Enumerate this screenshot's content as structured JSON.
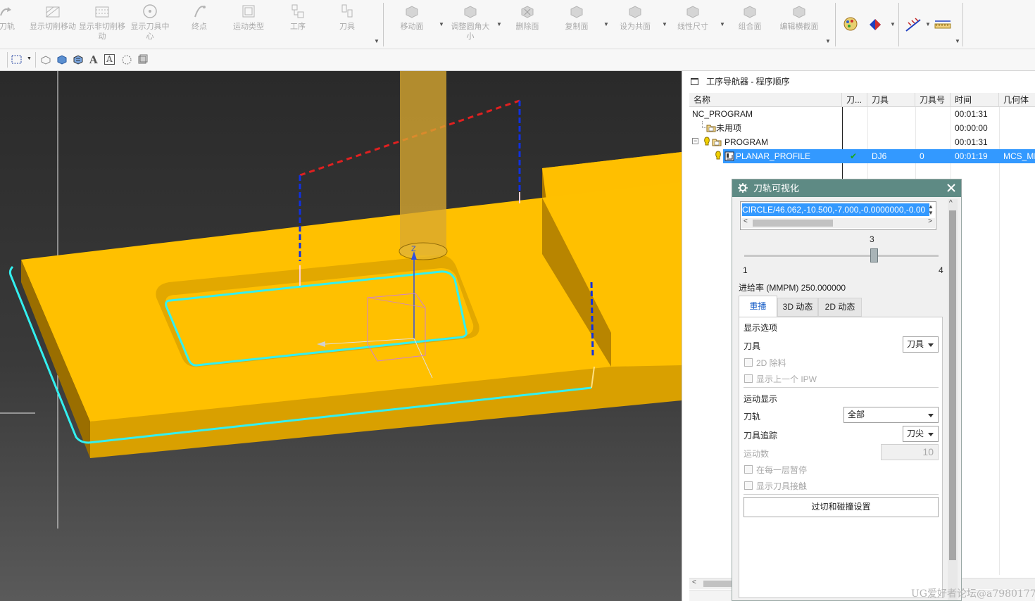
{
  "ribbon": {
    "items": [
      {
        "label": "刀轨",
        "icon": "toolpath-icon"
      },
      {
        "label": "显示切削移动",
        "icon": "show-cut-moves-icon"
      },
      {
        "label": "显示非切削移动",
        "icon": "show-noncut-moves-icon"
      },
      {
        "label": "显示刀具中心",
        "icon": "tool-center-icon"
      },
      {
        "label": "终点",
        "icon": "endpoint-icon"
      },
      {
        "label": "运动类型",
        "icon": "motion-type-icon"
      },
      {
        "label": "工序",
        "icon": "operation-icon"
      },
      {
        "label": "刀具",
        "icon": "tool-icon"
      },
      {
        "label": "移动面",
        "icon": "move-face-icon"
      },
      {
        "label": "调整圆角大小",
        "icon": "resize-blend-icon"
      },
      {
        "label": "删除面",
        "icon": "delete-face-icon"
      },
      {
        "label": "复制面",
        "icon": "copy-face-icon"
      },
      {
        "label": "设为共面",
        "icon": "make-coplanar-icon"
      },
      {
        "label": "线性尺寸",
        "icon": "linear-dimension-icon"
      },
      {
        "label": "组合面",
        "icon": "combine-faces-icon"
      },
      {
        "label": "编辑横截面",
        "icon": "edit-section-icon"
      }
    ]
  },
  "navigator": {
    "title": "工序导航器 - 程序顺序",
    "columns": [
      "名称",
      "刀...",
      "刀具",
      "刀具号",
      "时间",
      "几何体"
    ],
    "rows": [
      {
        "name": "NC_PROGRAM",
        "path": "",
        "tool": "",
        "toolno": "",
        "time": "00:01:31",
        "geom": ""
      },
      {
        "name": "未用项",
        "path": "",
        "tool": "",
        "toolno": "",
        "time": "00:00:00",
        "geom": ""
      },
      {
        "name": "PROGRAM",
        "path": "",
        "tool": "",
        "toolno": "",
        "time": "00:01:31",
        "geom": ""
      },
      {
        "name": "PLANAR_PROFILE",
        "path": "✔",
        "tool": "DJ6",
        "toolno": "0",
        "time": "00:01:19",
        "geom": "MCS_MI"
      }
    ]
  },
  "dialog": {
    "title": "刀轨可视化",
    "gcode_line": "CIRCLE/46.062,-10.500,-7.000,-0.0000000,-0.00",
    "slider": {
      "value": "3",
      "min": "1",
      "max": "4",
      "fraction": 0.667
    },
    "feedrate": "进给率 (MMPM) 250.000000",
    "tabs": [
      "重播",
      "3D 动态",
      "2D 动态"
    ],
    "display_options_title": "显示选项",
    "tool_label": "刀具",
    "tool_value": "刀具",
    "remove_2d": "2D 除料",
    "show_prev_ipw": "显示上一个 IPW",
    "motion_display_title": "运动显示",
    "toolpath_label": "刀轨",
    "toolpath_value": "全部",
    "tool_trace_label": "刀具追踪",
    "tool_trace_value": "刀尖",
    "motion_count_label": "运动数",
    "motion_count_value": "10",
    "pause_each_layer": "在每一层暂停",
    "show_tool_contact": "显示刀具接触",
    "gouge_button": "过切和碰撞设置"
  },
  "watermark": "UG爱好者论坛@a7980177",
  "colors": {
    "part_yellow": "#ffc000",
    "toolpath_cyan": "#33f0f0",
    "dialog_title_bg": "#5e8a84",
    "selection_blue": "#3399ff"
  }
}
